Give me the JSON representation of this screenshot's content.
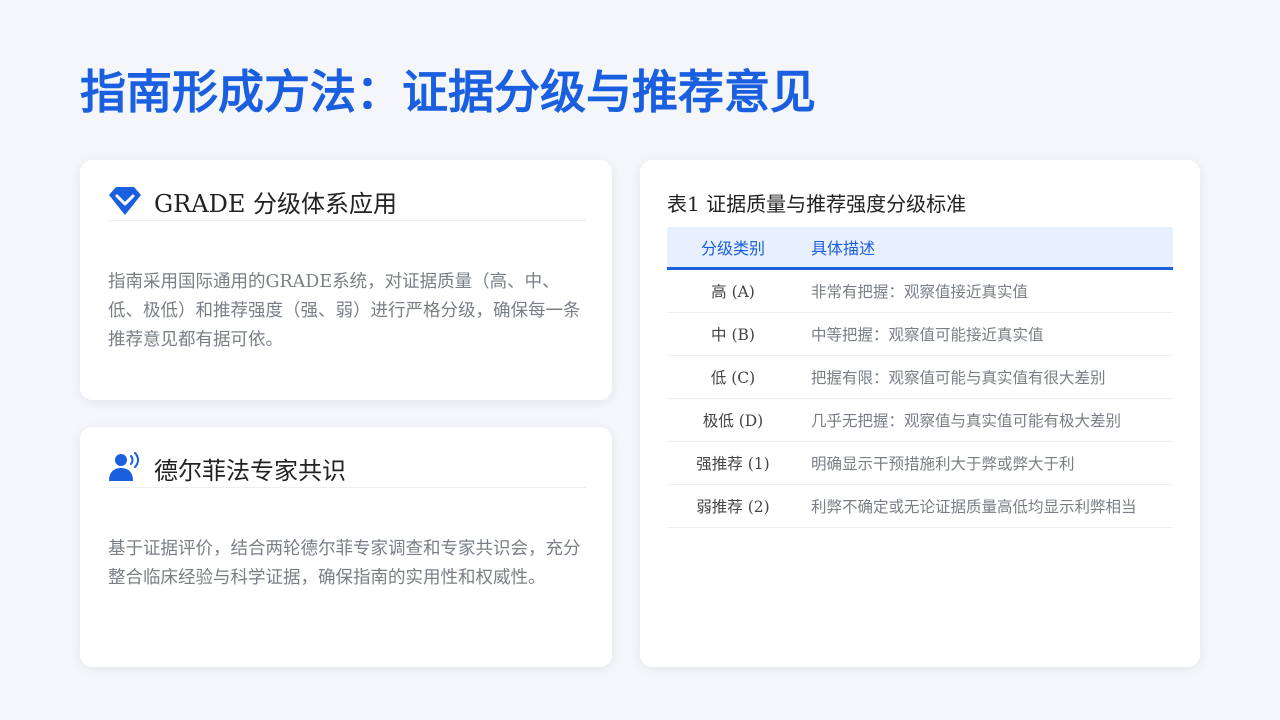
{
  "page": {
    "title": "指南形成方法：证据分级与推荐意见"
  },
  "grade_card": {
    "icon": "diamond-check-icon",
    "title": "GRADE 分级体系应用",
    "body": "指南采用国际通用的GRADE系统，对证据质量（高、中、低、极低）和推荐强度（强、弱）进行严格分级，确保每一条推荐意见都有据可依。"
  },
  "delphi_card": {
    "icon": "speaking-person-icon",
    "title": "德尔菲法专家共识",
    "body": "基于证据评价，结合两轮德尔菲专家调查和专家共识会，充分整合临床经验与科学证据，确保指南的实用性和权威性。"
  },
  "table": {
    "caption": "表1 证据质量与推荐强度分级标准",
    "headers": [
      "分级类别",
      "具体描述"
    ],
    "rows": [
      {
        "category": "高 (A)",
        "description": "非常有把握：观察值接近真实值"
      },
      {
        "category": "中 (B)",
        "description": "中等把握：观察值可能接近真实值"
      },
      {
        "category": "低 (C)",
        "description": "把握有限：观察值可能与真实值有很大差别"
      },
      {
        "category": "极低 (D)",
        "description": "几乎无把握：观察值与真实值可能有极大差别"
      },
      {
        "category": "强推荐 (1)",
        "description": "明确显示干预措施利大于弊或弊大于利"
      },
      {
        "category": "弱推荐 (2)",
        "description": "利弊不确定或无论证据质量高低均显示利弊相当"
      }
    ]
  },
  "colors": {
    "accent": "#1a5fe0",
    "background": "#f4f6f9",
    "header_fill": "#e8f0fd"
  }
}
